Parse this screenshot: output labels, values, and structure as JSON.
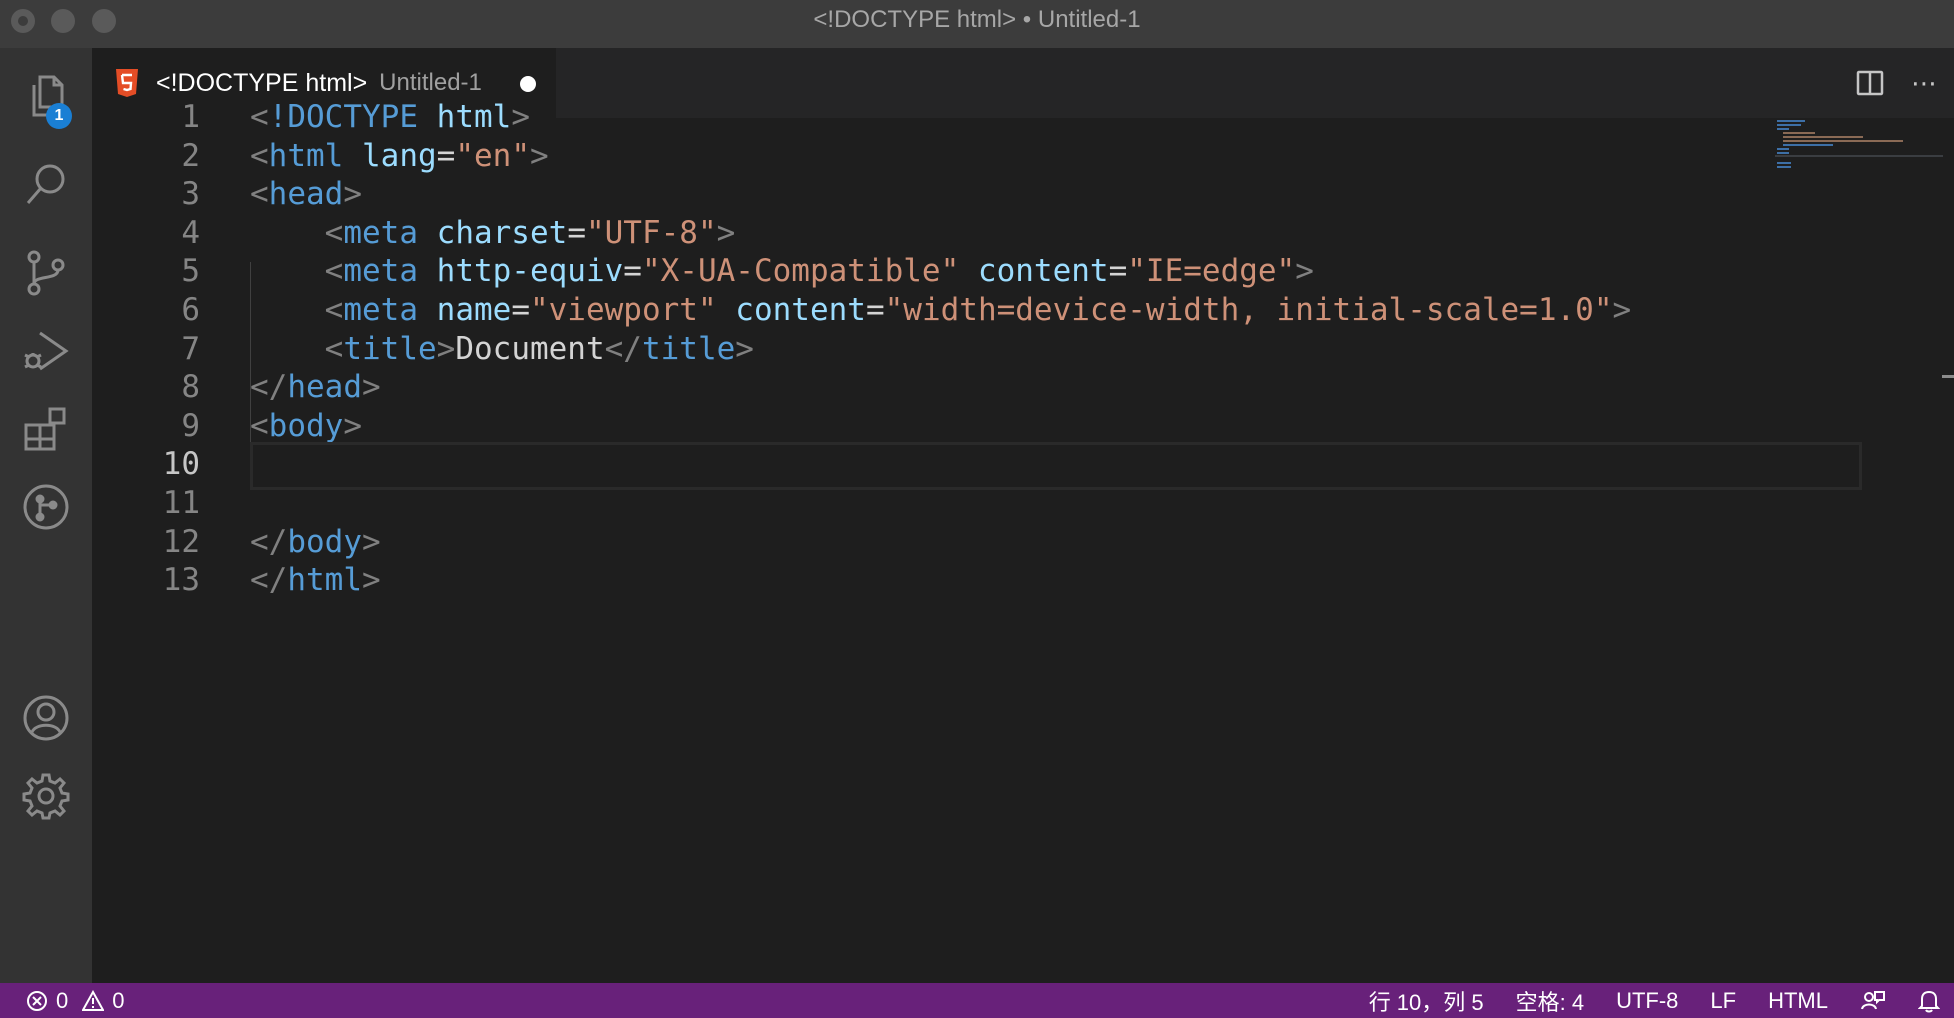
{
  "window": {
    "title": "<!DOCTYPE html> • Untitled-1"
  },
  "activity_bar": {
    "explorer_badge": "1",
    "items": [
      "explorer",
      "search",
      "source-control",
      "run-and-debug",
      "extensions",
      "git-graph",
      "accounts",
      "manage"
    ]
  },
  "tab": {
    "icon": "html5-icon",
    "name": "<!DOCTYPE html>",
    "description": "Untitled-1",
    "dirty": true
  },
  "tab_actions": {
    "split_editor": "split-editor-icon",
    "more": "⋯"
  },
  "editor": {
    "active_line": 10,
    "lines": [
      {
        "num": "1",
        "tokens": [
          {
            "t": "p",
            "v": "<"
          },
          {
            "t": "tag",
            "v": "!DOCTYPE"
          },
          {
            "t": "txt",
            "v": " "
          },
          {
            "t": "attr",
            "v": "html"
          },
          {
            "t": "p",
            "v": ">"
          }
        ]
      },
      {
        "num": "2",
        "tokens": [
          {
            "t": "p",
            "v": "<"
          },
          {
            "t": "tag",
            "v": "html"
          },
          {
            "t": "txt",
            "v": " "
          },
          {
            "t": "attr",
            "v": "lang"
          },
          {
            "t": "txt",
            "v": "="
          },
          {
            "t": "str",
            "v": "\"en\""
          },
          {
            "t": "p",
            "v": ">"
          }
        ]
      },
      {
        "num": "3",
        "tokens": [
          {
            "t": "p",
            "v": "<"
          },
          {
            "t": "tag",
            "v": "head"
          },
          {
            "t": "p",
            "v": ">"
          }
        ]
      },
      {
        "num": "4",
        "tokens": [
          {
            "t": "txt",
            "v": "    "
          },
          {
            "t": "p",
            "v": "<"
          },
          {
            "t": "tag",
            "v": "meta"
          },
          {
            "t": "txt",
            "v": " "
          },
          {
            "t": "attr",
            "v": "charset"
          },
          {
            "t": "txt",
            "v": "="
          },
          {
            "t": "str",
            "v": "\"UTF-8\""
          },
          {
            "t": "p",
            "v": ">"
          }
        ]
      },
      {
        "num": "5",
        "tokens": [
          {
            "t": "txt",
            "v": "    "
          },
          {
            "t": "p",
            "v": "<"
          },
          {
            "t": "tag",
            "v": "meta"
          },
          {
            "t": "txt",
            "v": " "
          },
          {
            "t": "attr",
            "v": "http-equiv"
          },
          {
            "t": "txt",
            "v": "="
          },
          {
            "t": "str",
            "v": "\"X-UA-Compatible\""
          },
          {
            "t": "txt",
            "v": " "
          },
          {
            "t": "attr",
            "v": "content"
          },
          {
            "t": "txt",
            "v": "="
          },
          {
            "t": "str",
            "v": "\"IE=edge\""
          },
          {
            "t": "p",
            "v": ">"
          }
        ]
      },
      {
        "num": "6",
        "tokens": [
          {
            "t": "txt",
            "v": "    "
          },
          {
            "t": "p",
            "v": "<"
          },
          {
            "t": "tag",
            "v": "meta"
          },
          {
            "t": "txt",
            "v": " "
          },
          {
            "t": "attr",
            "v": "name"
          },
          {
            "t": "txt",
            "v": "="
          },
          {
            "t": "str",
            "v": "\"viewport\""
          },
          {
            "t": "txt",
            "v": " "
          },
          {
            "t": "attr",
            "v": "content"
          },
          {
            "t": "txt",
            "v": "="
          },
          {
            "t": "str",
            "v": "\"width=device-width, initial-scale=1.0\""
          },
          {
            "t": "p",
            "v": ">"
          }
        ]
      },
      {
        "num": "7",
        "tokens": [
          {
            "t": "txt",
            "v": "    "
          },
          {
            "t": "p",
            "v": "<"
          },
          {
            "t": "tag",
            "v": "title"
          },
          {
            "t": "p",
            "v": ">"
          },
          {
            "t": "txt",
            "v": "Document"
          },
          {
            "t": "p",
            "v": "</"
          },
          {
            "t": "tag",
            "v": "title"
          },
          {
            "t": "p",
            "v": ">"
          }
        ]
      },
      {
        "num": "8",
        "tokens": [
          {
            "t": "p",
            "v": "</"
          },
          {
            "t": "tag",
            "v": "head"
          },
          {
            "t": "p",
            "v": ">"
          }
        ]
      },
      {
        "num": "9",
        "tokens": [
          {
            "t": "p",
            "v": "<"
          },
          {
            "t": "tag",
            "v": "body"
          },
          {
            "t": "p",
            "v": ">"
          }
        ]
      },
      {
        "num": "10",
        "tokens": []
      },
      {
        "num": "11",
        "tokens": []
      },
      {
        "num": "12",
        "tokens": [
          {
            "t": "p",
            "v": "</"
          },
          {
            "t": "tag",
            "v": "body"
          },
          {
            "t": "p",
            "v": ">"
          }
        ]
      },
      {
        "num": "13",
        "tokens": [
          {
            "t": "p",
            "v": "</"
          },
          {
            "t": "tag",
            "v": "html"
          },
          {
            "t": "p",
            "v": ">"
          }
        ]
      }
    ]
  },
  "status_bar": {
    "errors": "0",
    "warnings": "0",
    "cursor": "行 10，列 5",
    "indent": "空格: 4",
    "encoding": "UTF-8",
    "eol": "LF",
    "language": "HTML",
    "feedback_icon": "feedback-icon",
    "bell_icon": "bell-icon"
  },
  "colors": {
    "status_bar_bg": "#68217a",
    "activity_bar_bg": "#333333",
    "editor_bg": "#1e1e1e",
    "tag": "#569cd6",
    "attribute": "#9cdcfe",
    "string": "#ce9178",
    "punctuation": "#808080",
    "badge": "#1a7fd4",
    "html5_orange": "#e44d26"
  }
}
